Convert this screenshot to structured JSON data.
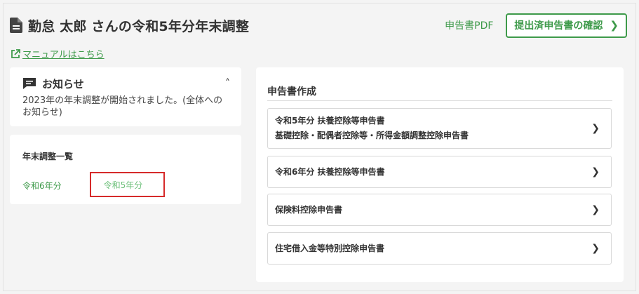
{
  "header": {
    "title": "勤怠 太郎 さんの令和5年分年末調整",
    "pdf_link": "申告書PDF",
    "confirm_button": "提出済申告書の確認"
  },
  "manual_link": "マニュアルはこちら",
  "notice": {
    "title": "お知らせ",
    "text": "2023年の年末調整が開始されました。(全体へのお知らせ)"
  },
  "adjustment": {
    "title": "年末調整一覧",
    "years": [
      "令和6年分",
      "令和5年分"
    ]
  },
  "forms": {
    "title": "申告書作成",
    "items": [
      {
        "line1": "令和5年分 扶養控除等申告書",
        "line2": "基礎控除・配偶者控除等・所得金額調整控除申告書"
      },
      {
        "line1": "令和6年分 扶養控除等申告書"
      },
      {
        "line1": "保険料控除申告書"
      },
      {
        "line1": "住宅借入金等特別控除申告書"
      }
    ]
  },
  "icons": {
    "title": "document-icon",
    "manual": "external-link-icon",
    "notice": "chat-icon",
    "collapse": "chevron-up-icon",
    "item": "chevron-right-icon"
  },
  "colors": {
    "accent": "#3e9a4a",
    "highlight_box": "#d62a2a"
  }
}
